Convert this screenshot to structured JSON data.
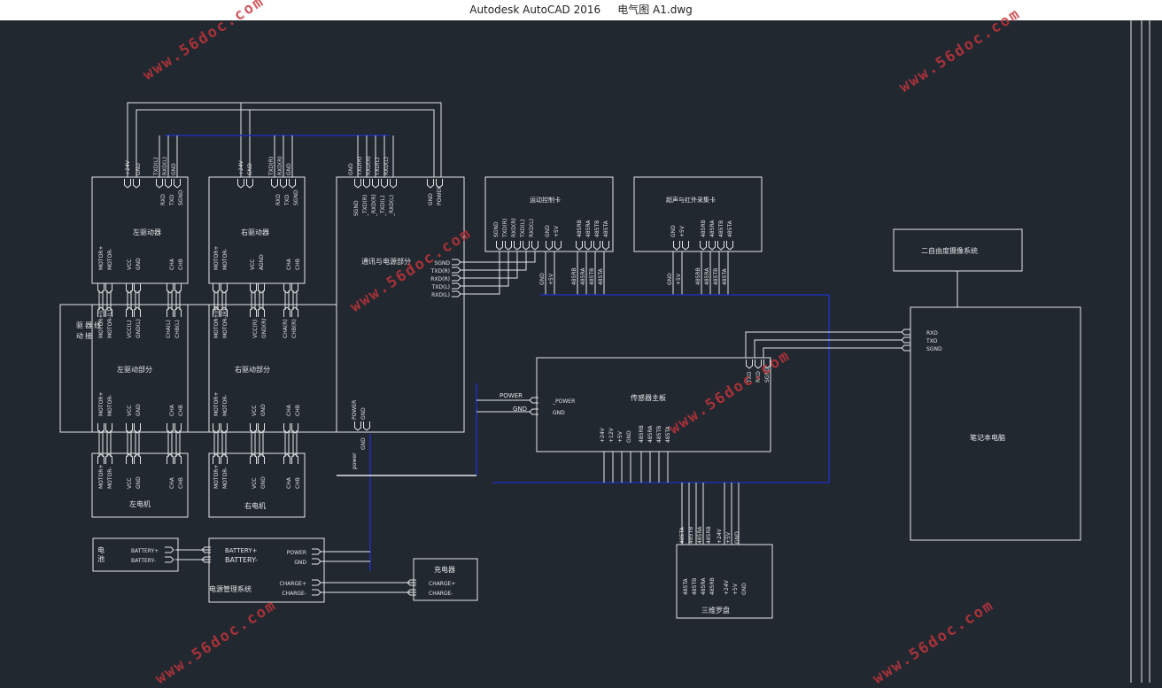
{
  "window": {
    "title": "Autodesk AutoCAD 2016     电气图 A1.dwg"
  },
  "watermark": "www.56doc.com",
  "colors": {
    "background": "#212830",
    "line": "#e6e6e6",
    "bus": "#1f2fb0",
    "watermark": "#c8343b"
  },
  "blocks": {
    "left_driver": {
      "title": "左驱动器",
      "top_pins": [
        "+24V",
        "GND",
        "TXD(L)",
        "RXD(L)",
        "GND"
      ],
      "top_labels": [
        "RXD",
        "TXD",
        "SGND"
      ],
      "bottom_pins": [
        "MOTOR+",
        "MOTOR-",
        "VCC",
        "GND",
        "CHA",
        "CHB"
      ]
    },
    "right_driver": {
      "title": "右驱动器",
      "top_pins": [
        "+24V",
        "GND",
        "TXD(R)",
        "RXD(R)",
        "GND"
      ],
      "top_labels": [
        "RXD",
        "TXD",
        "SGND"
      ],
      "bottom_pins": [
        "MOTOR+",
        "MOTOR-",
        "VCC",
        "AGND",
        "CHA",
        "CHB"
      ]
    },
    "drive_part": {
      "side_label": "驱动器接线",
      "left_title": "左驱动部分",
      "right_title": "右驱动部分",
      "left_top_pins": [
        "MOTOR+(L)",
        "MOTOR-(L)",
        "VCC(L)",
        "GND(L)",
        "CHA(L)",
        "CHB(L)"
      ],
      "right_top_pins": [
        "MOTOR+(R)",
        "MOTOR-(R)",
        "VCC(R)",
        "GND(R)",
        "CHA(R)",
        "CHB(R)"
      ],
      "left_bottom_pins": [
        "MOTOR+",
        "MOTOR-",
        "VCC",
        "GND",
        "CHA",
        "CHB"
      ],
      "right_bottom_pins": [
        "MOTOR+",
        "MOTOR-",
        "VCC",
        "GND",
        "CHA",
        "CHB"
      ]
    },
    "left_motor": {
      "title": "左电机",
      "pins": [
        "MOTOR+",
        "MOTOR-",
        "VCC",
        "GND",
        "CHA",
        "CHB"
      ]
    },
    "right_motor": {
      "title": "右电机",
      "pins": [
        "MOTOR+",
        "MOTOR-",
        "VCC",
        "GND",
        "CHA",
        "CHB"
      ]
    },
    "controller": {
      "title": "通讯与电源部分",
      "top_pins": [
        "GND",
        "TXD(R)",
        "RXD(R)",
        "TXD(L)",
        "RXD(L)"
      ],
      "top_labels": [
        "SGND",
        "_TXD(R)",
        "_RXD(R)",
        "_TXD(L)",
        "_RXD(L)"
      ],
      "power_pins": [
        "GND",
        "POWER"
      ],
      "right_pins": [
        "SGND",
        "TXD(R)",
        "RXD(R)",
        "TXD(L)",
        "RXD(L)"
      ],
      "bottom_pins": [
        "POWER",
        "GND"
      ],
      "bottom_labels": [
        "power",
        "GND"
      ]
    },
    "motion_card": {
      "title": "运动控制卡",
      "top_pins": [
        "SGND",
        "TXD(R)",
        "RXD(R)",
        "TXD(L)",
        "RXD(L)"
      ],
      "mid_pins": [
        "GND",
        "+5V",
        "485RB",
        "485RA",
        "485TB",
        "485TA"
      ],
      "bottom_pins": [
        "GND",
        "+5V",
        "485RB",
        "485RA",
        "485TB",
        "485TA"
      ]
    },
    "ir_card": {
      "title": "超声与红外采集卡",
      "mid_pins": [
        "GND",
        "+5V",
        "485RB",
        "485RA",
        "485TB",
        "485TA"
      ],
      "bottom_pins": [
        "GND",
        "+5V",
        "485RB",
        "485RA",
        "485TB",
        "485TA"
      ]
    },
    "sensor_board": {
      "title": "传感器主板",
      "left_pins": [
        "_POWER",
        "GND"
      ],
      "left_labels": [
        "POWER",
        "GND"
      ],
      "bottom_pins": [
        "+24V",
        "+12V",
        "+5V",
        "GND",
        "485RB",
        "485RA",
        "485TB",
        "485TA"
      ],
      "top_pins": [
        "TXD",
        "RXD",
        "SGND"
      ]
    },
    "laptop": {
      "title": "笔记本电脑",
      "pins": [
        "RXD",
        "TXD",
        "SGND"
      ]
    },
    "pan_tilt": {
      "title": "二自由度摄像系统"
    },
    "compass": {
      "title": "三维罗盘",
      "top_labels": [
        "485TA",
        "485TB",
        "485RA",
        "485RB",
        "+24V",
        "+5V",
        "GND"
      ],
      "pins": [
        "485TA",
        "485TB",
        "485RA",
        "485RB",
        "+24V",
        "+5V",
        "GND"
      ]
    },
    "battery": {
      "title": "电池",
      "pins": [
        "BATTERY+",
        "BATTERY-"
      ]
    },
    "power_mgmt": {
      "title": "电源管理系统",
      "left_pins": [
        "BATTERY+",
        "BATTERY-"
      ],
      "right_pins": [
        "POWER",
        "GND",
        "CHARGE+",
        "CHARGE-"
      ]
    },
    "charger": {
      "title": "充电器",
      "pins": [
        "CHARGE+",
        "CHARGE-"
      ]
    }
  }
}
